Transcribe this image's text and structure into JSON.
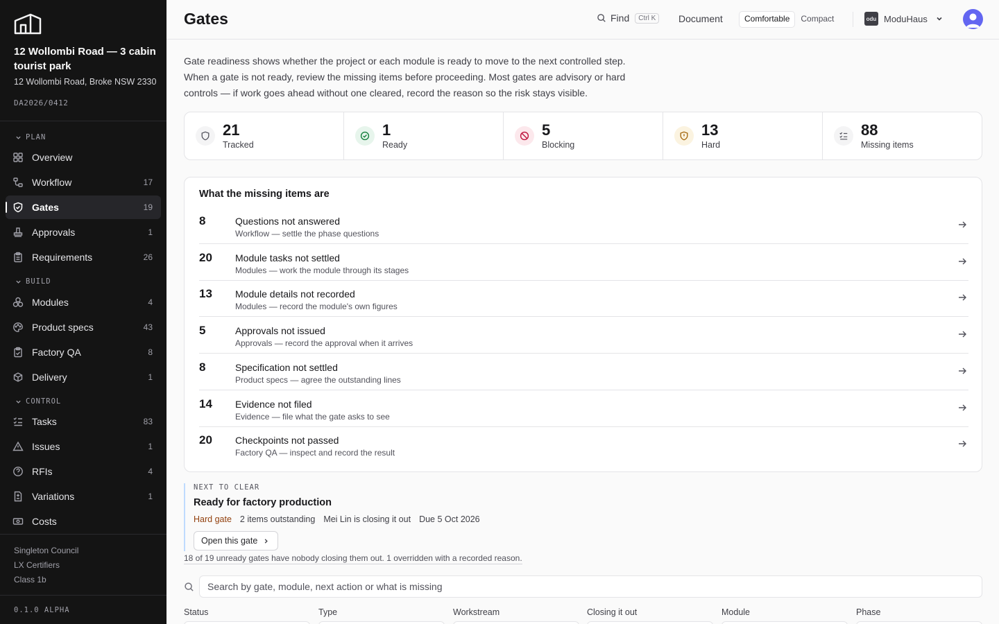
{
  "project": {
    "title": "12 Wollombi Road — 3 cabin tourist park",
    "address": "12 Wollombi Road, Broke NSW 2330",
    "da": "DA2026/0412"
  },
  "sidebar": {
    "sections": [
      {
        "label": "PLAN"
      },
      {
        "label": "BUILD"
      },
      {
        "label": "CONTROL"
      }
    ],
    "items": [
      {
        "label": "Overview",
        "count": "",
        "icon": "grid-icon"
      },
      {
        "label": "Workflow",
        "count": "17",
        "icon": "workflow-icon"
      },
      {
        "label": "Gates",
        "count": "19",
        "icon": "shield-check-icon",
        "active": true
      },
      {
        "label": "Approvals",
        "count": "1",
        "icon": "stamp-icon"
      },
      {
        "label": "Requirements",
        "count": "26",
        "icon": "clipboard-icon"
      },
      {
        "label": "Modules",
        "count": "4",
        "icon": "boxes-icon"
      },
      {
        "label": "Product specs",
        "count": "43",
        "icon": "palette-icon"
      },
      {
        "label": "Factory QA",
        "count": "8",
        "icon": "clipboard-check-icon"
      },
      {
        "label": "Delivery",
        "count": "1",
        "icon": "package-icon"
      },
      {
        "label": "Tasks",
        "count": "83",
        "icon": "list-checks-icon"
      },
      {
        "label": "Issues",
        "count": "1",
        "icon": "alert-triangle-icon"
      },
      {
        "label": "RFIs",
        "count": "4",
        "icon": "help-circle-icon"
      },
      {
        "label": "Variations",
        "count": "1",
        "icon": "file-diff-icon"
      },
      {
        "label": "Costs",
        "count": "",
        "icon": "banknote-icon"
      }
    ],
    "footer": [
      "Singleton Council",
      "LX Certifiers",
      "Class 1b"
    ],
    "version": "0.1.0 ALPHA"
  },
  "header": {
    "title": "Gates",
    "find_label": "Find",
    "find_shortcut": "Ctrl K",
    "document_label": "Document",
    "density_options": [
      "Comfortable",
      "Compact"
    ],
    "density_selected": "Comfortable",
    "org_name": "ModuHaus",
    "org_logo_text": "odu"
  },
  "intro": "Gate readiness shows whether the project or each module is ready to move to the next controlled step. When a gate is not ready, review the missing items before proceeding. Most gates are advisory or hard controls — if work goes ahead without one cleared, record the reason so the risk stays visible.",
  "stats": [
    {
      "value": "21",
      "label": "Tracked",
      "icon": "shield-icon",
      "bg": "#f4f4f5",
      "color": "#52525b"
    },
    {
      "value": "1",
      "label": "Ready",
      "icon": "check-circle-icon",
      "bg": "#e7f5ec",
      "color": "#15803d"
    },
    {
      "value": "5",
      "label": "Blocking",
      "icon": "ban-icon",
      "bg": "#fce8ec",
      "color": "#be123c"
    },
    {
      "value": "13",
      "label": "Hard",
      "icon": "shield-alert-icon",
      "bg": "#fbf3e0",
      "color": "#a16207"
    },
    {
      "value": "88",
      "label": "Missing items",
      "icon": "list-checks-icon",
      "bg": "#f4f4f5",
      "color": "#52525b"
    }
  ],
  "missing": {
    "title": "What the missing items are",
    "rows": [
      {
        "count": "8",
        "title": "Questions not answered",
        "sub": "Workflow — settle the phase questions"
      },
      {
        "count": "20",
        "title": "Module tasks not settled",
        "sub": "Modules — work the module through its stages"
      },
      {
        "count": "13",
        "title": "Module details not recorded",
        "sub": "Modules — record the module's own figures"
      },
      {
        "count": "5",
        "title": "Approvals not issued",
        "sub": "Approvals — record the approval when it arrives"
      },
      {
        "count": "8",
        "title": "Specification not settled",
        "sub": "Product specs — agree the outstanding lines"
      },
      {
        "count": "14",
        "title": "Evidence not filed",
        "sub": "Evidence — file what the gate asks to see"
      },
      {
        "count": "20",
        "title": "Checkpoints not passed",
        "sub": "Factory QA — inspect and record the result"
      }
    ]
  },
  "next": {
    "label": "NEXT TO CLEAR",
    "title": "Ready for factory production",
    "gate_type": "Hard gate",
    "outstanding": "2 items outstanding",
    "owner": "Mei Lin is closing it out",
    "due": "Due 5 Oct 2026",
    "button": "Open this gate"
  },
  "unready_note": "18 of 19 unready gates have nobody closing them out. 1 overridden with a recorded reason.",
  "search": {
    "placeholder": "Search by gate, module, next action or what is missing",
    "value": ""
  },
  "filters": [
    "Status",
    "Type",
    "Workstream",
    "Closing it out",
    "Module",
    "Phase"
  ]
}
